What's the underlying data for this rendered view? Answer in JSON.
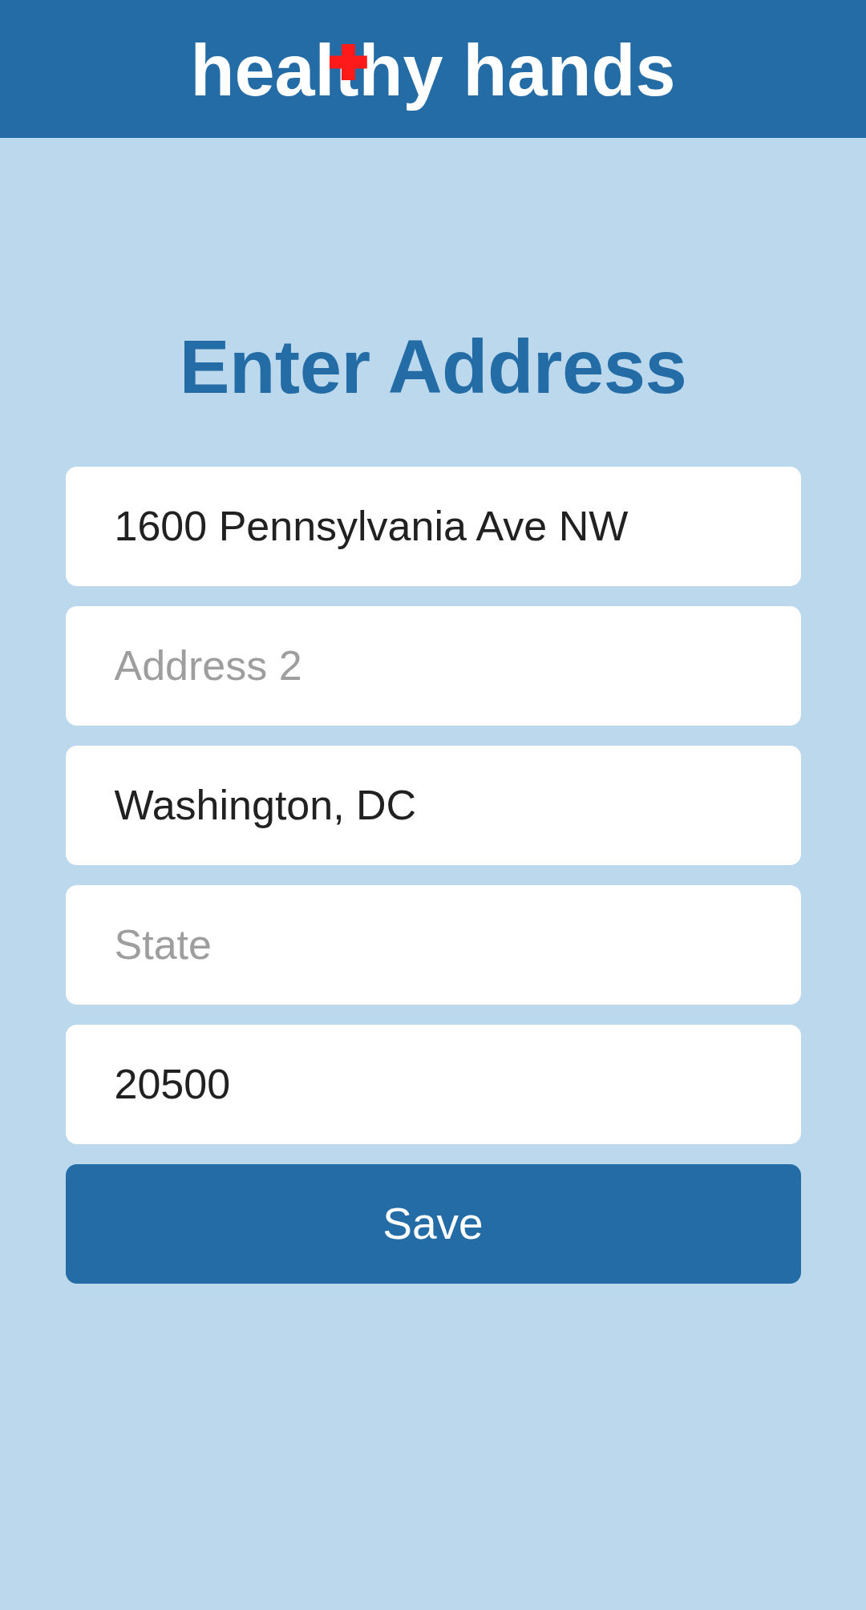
{
  "header": {
    "logo": "healthy hands"
  },
  "title": "Enter Address",
  "fields": [
    {
      "value": "1600 Pennsylvania Ave NW"
    },
    {
      "placeholder": "Address 2"
    },
    {
      "value": "Washington, DC"
    },
    {
      "placeholder": "State"
    },
    {
      "value": "20500"
    }
  ],
  "save_button": {
    "label": "Save"
  }
}
